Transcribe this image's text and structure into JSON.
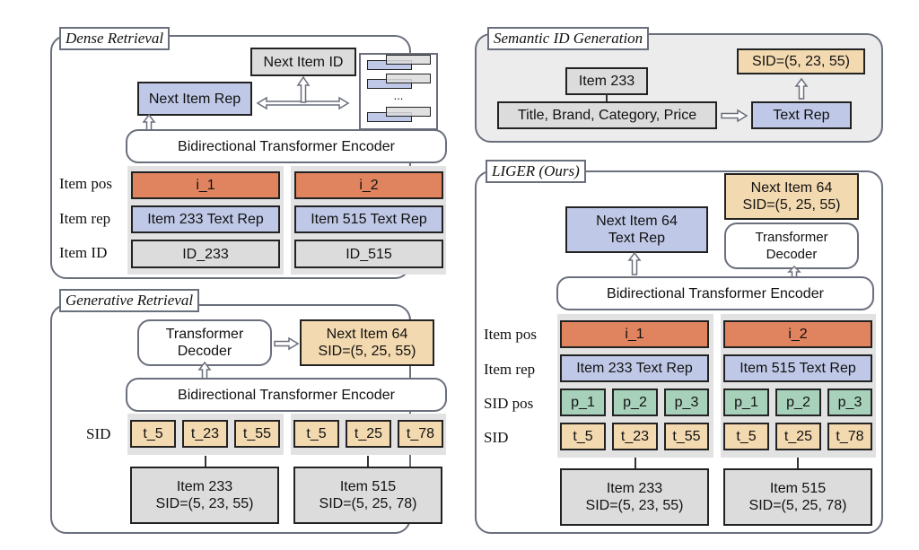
{
  "dense": {
    "title": "Dense Retrieval",
    "next_item_id": "Next Item ID",
    "next_item_rep": "Next Item Rep",
    "ellipsis": "...",
    "encoder": "Bidirectional Transformer Encoder",
    "row_labels": [
      "Item pos",
      "Item rep",
      "Item ID"
    ],
    "items": [
      {
        "pos": "i_1",
        "rep": "Item 233 Text Rep",
        "id": "ID_233"
      },
      {
        "pos": "i_2",
        "rep": "Item 515 Text Rep",
        "id": "ID_515"
      }
    ]
  },
  "generative": {
    "title": "Generative Retrieval",
    "decoder": "Transformer\nDecoder",
    "output": "Next Item 64\nSID=(5, 25, 55)",
    "encoder": "Bidirectional Transformer Encoder",
    "row_label": "SID",
    "items": [
      {
        "tokens": [
          "t_5",
          "t_23",
          "t_55"
        ],
        "item": "Item 233\nSID=(5, 23, 55)"
      },
      {
        "tokens": [
          "t_5",
          "t_25",
          "t_78"
        ],
        "item": "Item 515\nSID=(5, 25, 78)"
      }
    ]
  },
  "semantic": {
    "title": "Semantic ID Generation",
    "item": "Item 233",
    "attributes": "Title, Brand, Category, Price",
    "text_rep": "Text Rep",
    "sid": "SID=(5, 23, 55)"
  },
  "liger": {
    "title": "LIGER (Ours)",
    "next_text_rep": "Next Item 64\nText Rep",
    "next_sid": "Next Item 64\nSID=(5, 25, 55)",
    "decoder": "Transformer\nDecoder",
    "encoder": "Bidirectional Transformer Encoder",
    "row_labels": [
      "Item pos",
      "Item rep",
      "SID pos",
      "SID"
    ],
    "items": [
      {
        "pos": "i_1",
        "rep": "Item 233 Text Rep",
        "sid_pos": [
          "p_1",
          "p_2",
          "p_3"
        ],
        "tokens": [
          "t_5",
          "t_23",
          "t_55"
        ],
        "item": "Item 233\nSID=(5, 23, 55)"
      },
      {
        "pos": "i_2",
        "rep": "Item 515 Text Rep",
        "sid_pos": [
          "p_1",
          "p_2",
          "p_3"
        ],
        "tokens": [
          "t_5",
          "t_25",
          "t_78"
        ],
        "item": "Item 515\nSID=(5, 25, 78)"
      }
    ]
  },
  "colors": {
    "item_pos": "#e0845f",
    "item_rep": "#bfc8e6",
    "item_id": "#dcdcdc",
    "sid_token": "#f3d9b0",
    "sid_pos": "#a8d1bb",
    "panel_border": "#6a6f7c"
  }
}
